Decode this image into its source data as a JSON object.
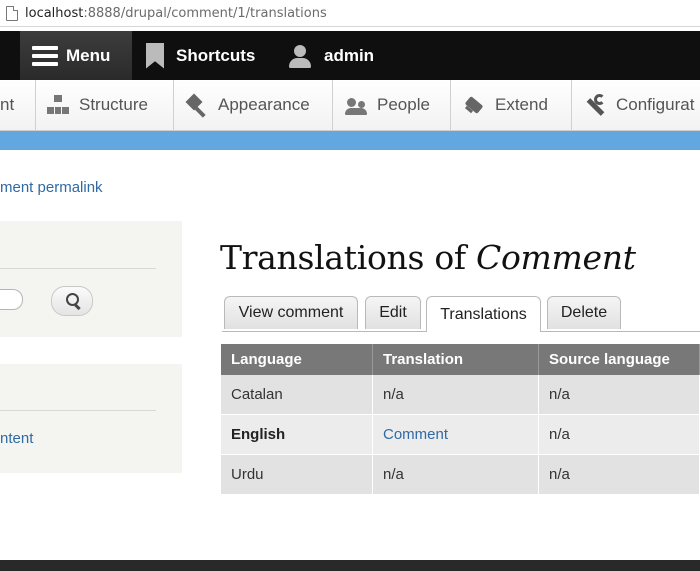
{
  "browser": {
    "url_host": "localhost",
    "url_rest": ":8888/drupal/comment/1/translations"
  },
  "toolbar": {
    "menu_label": "Menu",
    "shortcuts_label": "Shortcuts",
    "user_label": "admin"
  },
  "tray": {
    "items": [
      {
        "label": "nt",
        "icon": "none"
      },
      {
        "label": "Structure",
        "icon": "structure-icon"
      },
      {
        "label": "Appearance",
        "icon": "appearance-icon"
      },
      {
        "label": "People",
        "icon": "people-icon"
      },
      {
        "label": "Extend",
        "icon": "extend-icon"
      },
      {
        "label": "Configurat",
        "icon": "configuration-icon"
      }
    ]
  },
  "breadcrumb": {
    "permalink": "ment permalink"
  },
  "sidebar": {
    "link": "ntent"
  },
  "main": {
    "title_prefix": "Translations of ",
    "title_entity": "Comment",
    "tabs": [
      {
        "label": "View comment",
        "active": false
      },
      {
        "label": "Edit",
        "active": false
      },
      {
        "label": "Translations",
        "active": true
      },
      {
        "label": "Delete",
        "active": false
      }
    ]
  },
  "table": {
    "headers": [
      "Language",
      "Translation",
      "Source language"
    ],
    "rows": [
      {
        "language": "Catalan",
        "translation": "n/a",
        "source": "n/a",
        "translation_is_link": false,
        "bold": false
      },
      {
        "language": "English",
        "translation": "Comment",
        "source": "n/a",
        "translation_is_link": true,
        "bold": true
      },
      {
        "language": "Urdu",
        "translation": "n/a",
        "source": "n/a",
        "translation_is_link": false,
        "bold": false
      }
    ]
  },
  "colors": {
    "toolbar_bg": "#0f0f0f",
    "accent_blue": "#63a7e0",
    "link": "#2f6aa5",
    "table_header": "#787878"
  }
}
